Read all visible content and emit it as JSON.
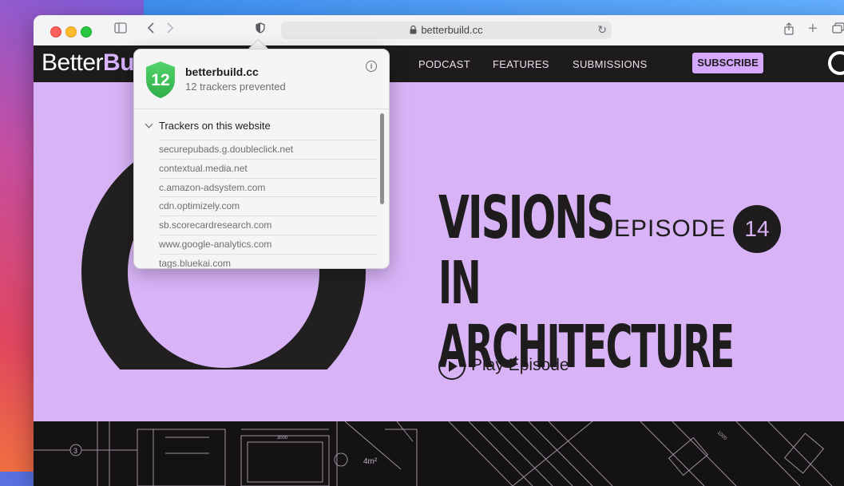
{
  "browser": {
    "url": "betterbuild.cc"
  },
  "site": {
    "logo_part1": "Better",
    "logo_part2": "Bu",
    "nav": [
      "PODCAST",
      "FEATURES",
      "SUBMISSIONS"
    ],
    "subscribe_label": "SUBSCRIBE"
  },
  "hero": {
    "title_line1": "VISIONS",
    "title_line2": "IN ARCHITECTURE",
    "episode_label": "EPISODE",
    "episode_number": "14",
    "play_label": "Play Episode",
    "background_color": "#d8b4f7"
  },
  "blueprint": {
    "labels": [
      "3",
      "4m²",
      "3000",
      "1000"
    ]
  },
  "privacy_popover": {
    "shield_count": "12",
    "site": "betterbuild.cc",
    "summary": "12 trackers prevented",
    "section_title": "Trackers on this website",
    "trackers": [
      "securepubads.g.doubleclick.net",
      "contextual.media.net",
      "c.amazon-adsystem.com",
      "cdn.optimizely.com",
      "sb.scorecardresearch.com",
      "www.google-analytics.com",
      "tags.bluekai.com"
    ]
  },
  "colors": {
    "accent": "#d6a8ff",
    "nav_bg": "#1e1b1c",
    "shield_green": "#3ec25a"
  }
}
